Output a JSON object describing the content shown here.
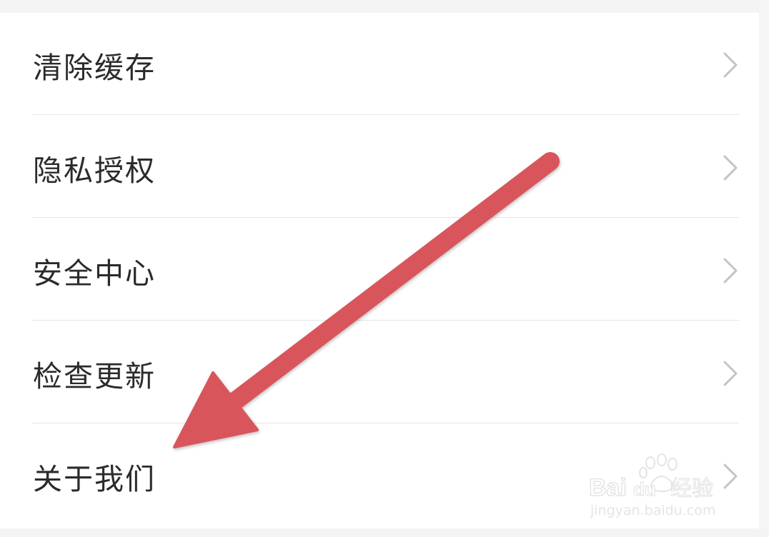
{
  "settings": {
    "items": [
      {
        "label": "清除缓存",
        "icon": "chevron-right-icon"
      },
      {
        "label": "隐私授权",
        "icon": "chevron-right-icon"
      },
      {
        "label": "安全中心",
        "icon": "chevron-right-icon"
      },
      {
        "label": "检查更新",
        "icon": "chevron-right-icon"
      },
      {
        "label": "关于我们",
        "icon": "chevron-right-icon"
      }
    ]
  },
  "annotation": {
    "arrow_color": "#d9545c"
  },
  "watermark": {
    "brand_text": "Baidu经验",
    "url": "jingyan.baidu.com"
  },
  "colors": {
    "text": "#2b2b2b",
    "chevron": "#c4c4c4",
    "divider": "#e6e6e6",
    "background": "#ffffff"
  }
}
